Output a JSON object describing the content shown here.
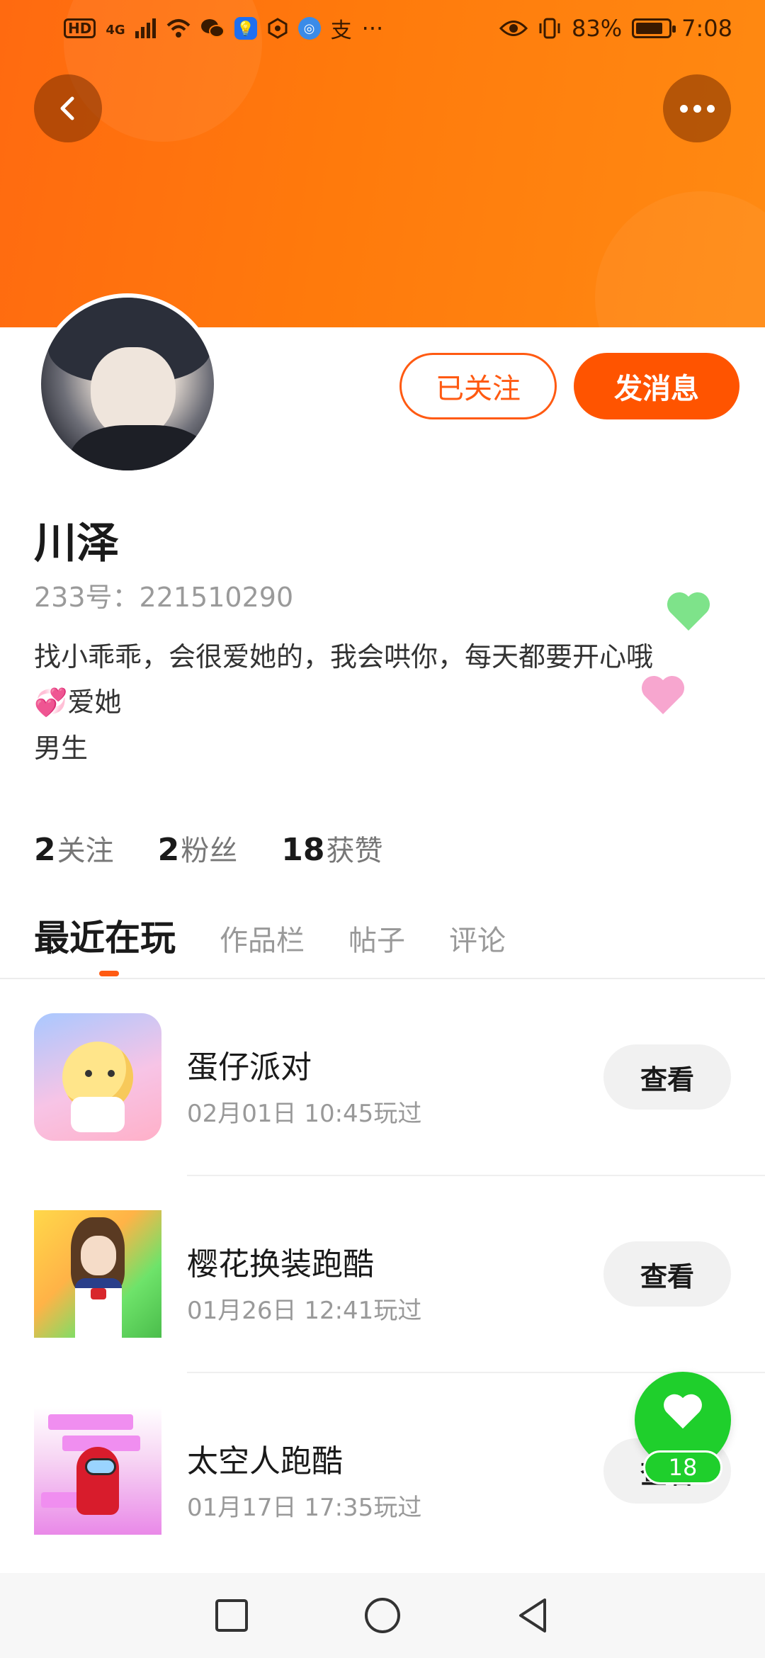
{
  "status_bar": {
    "network_hd": "HD",
    "network_gen": "4G",
    "battery_percent": "83%",
    "battery_level": 0.83,
    "time": "7:08",
    "more_indicator": "···",
    "app_icons": [
      "wechat-icon",
      "lightbulb-app-icon",
      "hexagon-app-icon",
      "browser-app-icon",
      "alipay-icon"
    ]
  },
  "header": {
    "back_icon": "chevron-left-icon",
    "more_icon": "more-dots-icon"
  },
  "profile": {
    "name": "川泽",
    "uid": "233号：221510290",
    "bio_line1": "找小乖乖，会很爱她的，我会哄你，每天都要开心哦",
    "bio_emoji": "💞",
    "bio_line2": "爱她",
    "gender": "男生",
    "follow_button": "已关注",
    "message_button": "发消息"
  },
  "stats": [
    {
      "value": "2",
      "label": "关注"
    },
    {
      "value": "2",
      "label": "粉丝"
    },
    {
      "value": "18",
      "label": "获赞"
    }
  ],
  "tabs": [
    {
      "label": "最近在玩",
      "active": true
    },
    {
      "label": "作品栏",
      "active": false
    },
    {
      "label": "帖子",
      "active": false
    },
    {
      "label": "评论",
      "active": false
    }
  ],
  "recent_games": [
    {
      "title": "蛋仔派对",
      "time": "02月01日 10:45玩过",
      "action": "查看"
    },
    {
      "title": "樱花换装跑酷",
      "time": "01月26日 12:41玩过",
      "action": "查看"
    },
    {
      "title": "太空人跑酷",
      "time": "01月17日 17:35玩过",
      "action": "查看"
    }
  ],
  "like_bubble": {
    "count": "18"
  },
  "colors": {
    "accent": "#ff5400",
    "banner_start": "#ff6a10",
    "banner_end": "#ff8a12",
    "like_green": "#1fcf2c"
  },
  "navbar": {
    "icons": [
      "recent-apps-icon",
      "home-icon",
      "back-icon"
    ]
  }
}
